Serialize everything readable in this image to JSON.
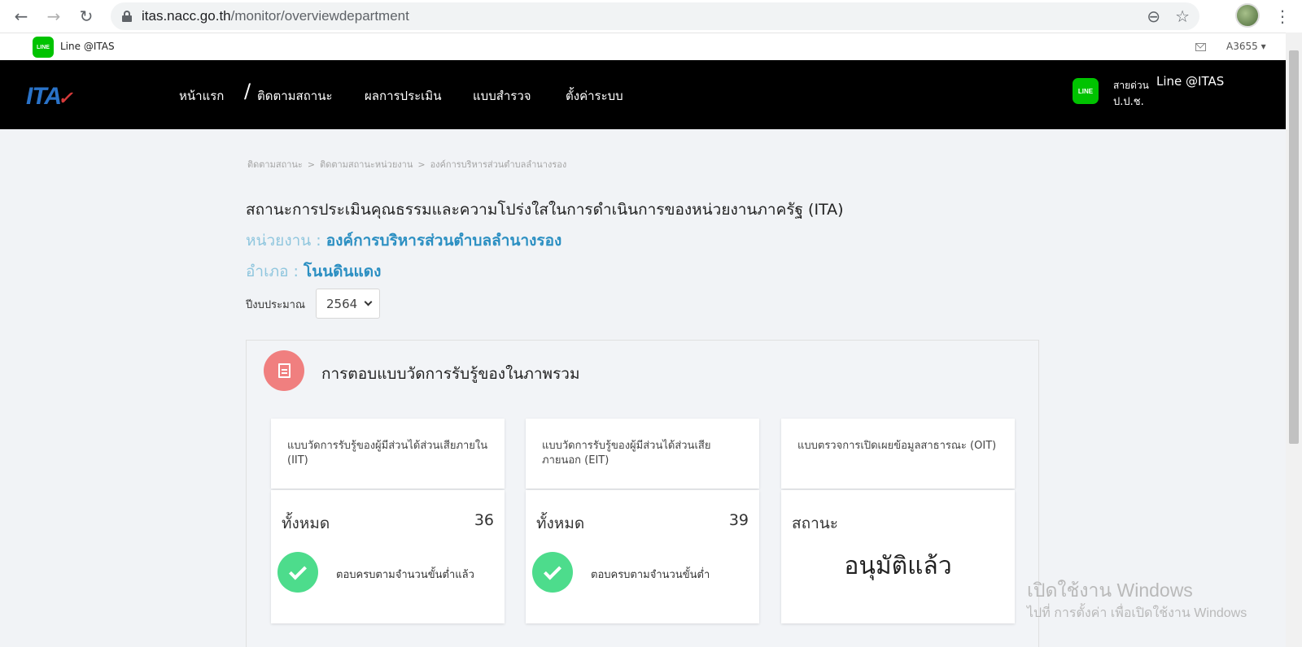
{
  "browser": {
    "url_domain": "itas.nacc.go.th",
    "url_path": "/monitor/overviewdepartment",
    "back_icon": "arrow-left-icon",
    "forward_icon": "arrow-right-icon",
    "reload_icon": "reload-icon"
  },
  "topbar": {
    "line_label": "Line @ITAS",
    "line_logo_text": "LINE",
    "user": "A3655 ▾"
  },
  "nav": {
    "logo": "ITA",
    "logo_mark": "✓",
    "items": [
      "หน้าแรก",
      "ติดตามสถานะ",
      "ผลการประเมิน",
      "แบบสำรวจ",
      "ตั้งค่าระบบ"
    ],
    "slash": "/",
    "hotline_a": "สายด่วน",
    "hotline_b": "Line @ITAS",
    "hotline_c": "ป.ป.ช."
  },
  "breadcrumb": [
    "ติดตามสถานะ",
    "ติดตามสถานะหน่วยงาน",
    "องค์การบริหารส่วนตำบลลำนางรอง"
  ],
  "page": {
    "title": "สถานะการประเมินคุณธรรมและความโปร่งใสในการดำเนินการของหน่วยงานภาครัฐ (ITA)",
    "agency_label": "หน่วยงาน : ",
    "agency_value": "องค์การบริหารส่วนตำบลลำนางรอง",
    "district_label": "อำเภอ : ",
    "district_value": "โนนดินแดง",
    "year_label": "ปีงบประมาณ",
    "year_value": "2564"
  },
  "panel": {
    "title": "การตอบแบบวัดการรับรู้ของในภาพรวม",
    "cards": [
      {
        "title": "แบบวัดการรับรู้ของผู้มีส่วนได้ส่วนเสียภายใน (IIT)",
        "total_label": "ทั้งหมด",
        "total": "36",
        "status": "ตอบครบตามจำนวนขั้นต่ำแล้ว"
      },
      {
        "title": "แบบวัดการรับรู้ของผู้มีส่วนได้ส่วนเสียภายนอก (EIT)",
        "total_label": "ทั้งหมด",
        "total": "39",
        "status": "ตอบครบตามจำนวนขั้นต่ำ"
      },
      {
        "title": "แบบตรวจการเปิดเผยข้อมูลสาธารณะ (OIT)",
        "status_label": "สถานะ",
        "status_value": "อนุมัติแล้ว"
      }
    ]
  },
  "watermark": {
    "line1": "เปิดใช้งาน Windows",
    "line2": "ไปที่ การตั้งค่า เพื่อเปิดใช้งาน Windows"
  },
  "colors": {
    "nav_bg": "#000000",
    "line_green": "#00c300",
    "accent_blue": "#2b8fc2",
    "check_green": "#4ddc8c",
    "panel_icon": "#f07f7f"
  }
}
